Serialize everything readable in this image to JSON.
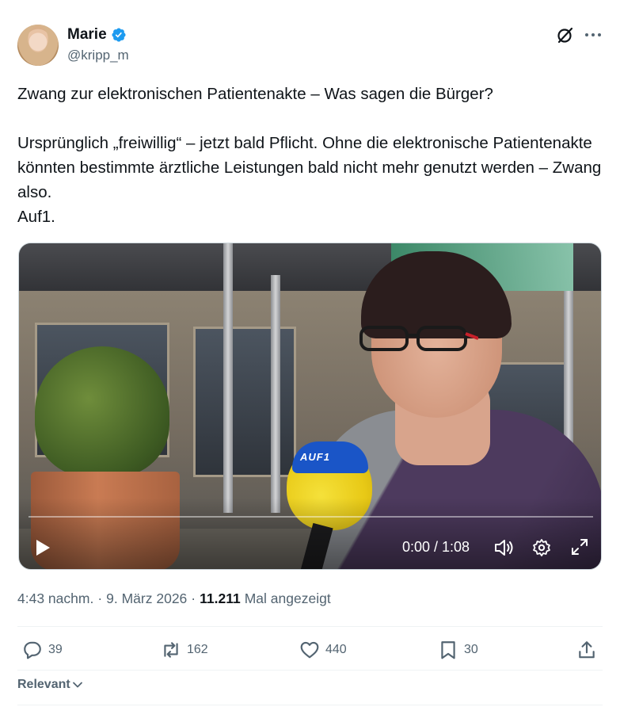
{
  "author": {
    "name": "Marie",
    "handle": "@kripp_m",
    "verified": true
  },
  "tweet": {
    "title_line": "Zwang zur elektronischen Patientenakte – Was sagen die Bürger?",
    "body": "Ursprünglich „freiwillig“ – jetzt bald Pflicht. Ohne die elektronische Patientenakte könnten bestimmte ärztliche Leistungen bald nicht mehr genutzt werden – Zwang also.\nAuf1."
  },
  "video": {
    "mic_brand": "AUF1",
    "time": "0:00 / 1:08",
    "progress": 0.0
  },
  "meta": {
    "time": "4:43 nachm.",
    "date": "9. März 2026",
    "views_count": "11.211",
    "views_label": "Mal angezeigt"
  },
  "actions": {
    "replies": "39",
    "reposts": "162",
    "likes": "440",
    "bookmarks": "30"
  },
  "sort": {
    "label": "Relevant"
  },
  "colors": {
    "verified_blue": "#1d9bf0",
    "text_primary": "#0f1419",
    "text_secondary": "#536471"
  },
  "icons": {
    "verified": "verified-badge-icon",
    "grok": "grok-icon",
    "more": "more-icon",
    "play": "play-icon",
    "volume": "volume-icon",
    "settings": "settings-icon",
    "fullscreen": "fullscreen-icon",
    "reply": "reply-icon",
    "repost": "repost-icon",
    "like": "like-icon",
    "bookmark": "bookmark-icon",
    "share": "share-icon",
    "chevron": "chevron-down-icon"
  }
}
